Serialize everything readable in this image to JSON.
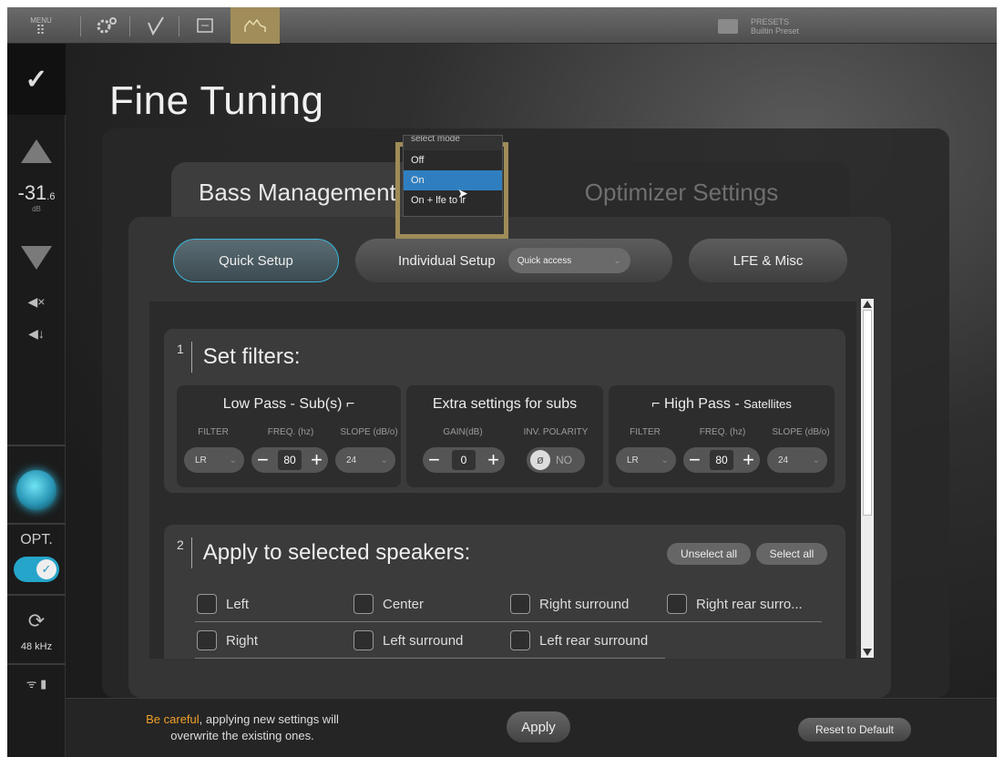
{
  "topbar": {
    "menu_label": "MENU",
    "menu_dots": "⠿",
    "icons": [
      "speaker-settings-icon",
      "check-icon",
      "display-icon",
      "room-curve-icon"
    ],
    "presets_label": "PRESETS",
    "preset_name": "Builtin Preset"
  },
  "sidebar": {
    "logo": "✓",
    "volume_main": "-31",
    "volume_decimal": ".6",
    "volume_unit": "dB",
    "mute_glyph": "◀×",
    "mute2_glyph": "◀↓",
    "opt_label": "OPT.",
    "toggle_glyph": "✓",
    "sync_glyph": "⟳",
    "sample_rate": "48 kHz",
    "wifi_glyph": "ᯤ ▮"
  },
  "page_title": "Fine Tuning",
  "tabs": {
    "bass": "Bass Management",
    "optimizer": "Optimizer Settings"
  },
  "subnav": {
    "quick": "Quick Setup",
    "individual": "Individual Setup",
    "quick_access": "Quick access",
    "lfe": "LFE & Misc"
  },
  "dropdown": {
    "header": "select mode",
    "options": [
      "Off",
      "On",
      "On + lfe to lr"
    ],
    "selected": "On"
  },
  "section1": {
    "num": "1",
    "title": "Set filters:",
    "low_pass": {
      "title": "Low Pass - Sub(s)",
      "filter_label": "FILTER",
      "freq_label": "FREQ. (hz)",
      "slope_label": "SLOPE (dB/o)",
      "filter": "LR",
      "freq": "80",
      "slope": "24"
    },
    "extra": {
      "title": "Extra settings for subs",
      "gain_label": "GAIN(dB)",
      "inv_label": "INV. POLARITY",
      "gain": "0",
      "inv": "NO"
    },
    "high_pass": {
      "title": "High Pass - ",
      "title_small": "Satellites",
      "filter_label": "FILTER",
      "freq_label": "FREQ. (hz)",
      "slope_label": "SLOPE (dB/o)",
      "filter": "LR",
      "freq": "80",
      "slope": "24"
    }
  },
  "section2": {
    "num": "2",
    "title": "Apply to selected speakers:",
    "unselect_all": "Unselect all",
    "select_all": "Select all",
    "speakers_row1": [
      "Left",
      "Center",
      "Right surround",
      "Right rear surro..."
    ],
    "speakers_row2": [
      "Right",
      "Left surround",
      "Left rear surround"
    ]
  },
  "bottom": {
    "warn_em": "Be careful",
    "warn_rest": ", applying new settings will",
    "warn_line2": "overwrite the existing ones.",
    "apply": "Apply",
    "reset": "Reset to Default"
  }
}
